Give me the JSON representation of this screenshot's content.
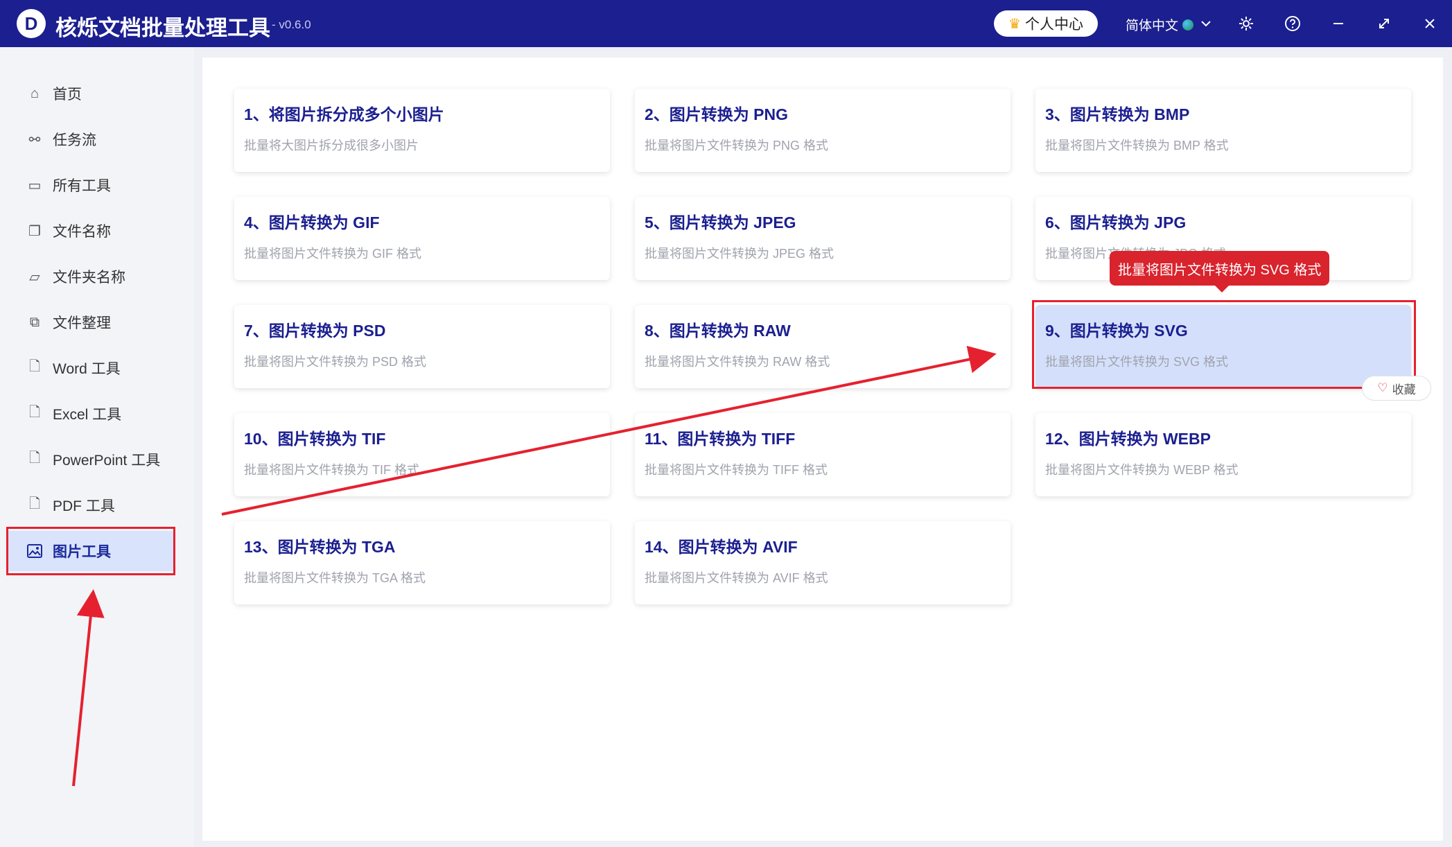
{
  "titlebar": {
    "logo_letter": "D",
    "title": "核烁文档批量处理工具",
    "version": "- v0.6.0",
    "user_center": "个人中心",
    "language": "简体中文",
    "icons": [
      "chevron-down-icon",
      "gear-icon",
      "help-icon",
      "minimize-icon",
      "maximize-icon",
      "close-icon"
    ]
  },
  "sidebar": {
    "items": [
      {
        "label": "首页",
        "icon": "home-icon"
      },
      {
        "label": "任务流",
        "icon": "workflow-icon"
      },
      {
        "label": "所有工具",
        "icon": "monitor-icon"
      },
      {
        "label": "文件名称",
        "icon": "file-name-icon"
      },
      {
        "label": "文件夹名称",
        "icon": "folder-icon"
      },
      {
        "label": "文件整理",
        "icon": "organize-icon"
      },
      {
        "label": "Word 工具",
        "icon": "word-icon"
      },
      {
        "label": "Excel 工具",
        "icon": "excel-icon"
      },
      {
        "label": "PowerPoint 工具",
        "icon": "powerpoint-icon"
      },
      {
        "label": "PDF 工具",
        "icon": "pdf-icon"
      },
      {
        "label": "图片工具",
        "icon": "image-icon",
        "active": true
      }
    ]
  },
  "tools": [
    {
      "title": "1、将图片拆分成多个小图片",
      "desc": "批量将大图片拆分成很多小图片"
    },
    {
      "title": "2、图片转换为 PNG",
      "desc": "批量将图片文件转换为 PNG 格式"
    },
    {
      "title": "3、图片转换为 BMP",
      "desc": "批量将图片文件转换为 BMP 格式"
    },
    {
      "title": "4、图片转换为 GIF",
      "desc": "批量将图片文件转换为 GIF 格式"
    },
    {
      "title": "5、图片转换为 JPEG",
      "desc": "批量将图片文件转换为 JPEG 格式"
    },
    {
      "title": "6、图片转换为 JPG",
      "desc": "批量将图片文件转换为 JPG 格式"
    },
    {
      "title": "7、图片转换为 PSD",
      "desc": "批量将图片文件转换为 PSD 格式"
    },
    {
      "title": "8、图片转换为 RAW",
      "desc": "批量将图片文件转换为 RAW 格式"
    },
    {
      "title": "9、图片转换为 SVG",
      "desc": "批量将图片文件转换为 SVG 格式",
      "selected": true
    },
    {
      "title": "10、图片转换为 TIF",
      "desc": "批量将图片文件转换为 TIF 格式"
    },
    {
      "title": "11、图片转换为 TIFF",
      "desc": "批量将图片文件转换为 TIFF 格式"
    },
    {
      "title": "12、图片转换为 WEBP",
      "desc": "批量将图片文件转换为 WEBP 格式"
    },
    {
      "title": "13、图片转换为 TGA",
      "desc": "批量将图片文件转换为 TGA 格式"
    },
    {
      "title": "14、图片转换为 AVIF",
      "desc": "批量将图片文件转换为 AVIF 格式"
    }
  ],
  "tooltip": "批量将图片文件转换为 SVG 格式",
  "favorite_label": "收藏",
  "colors": {
    "titlebar": "#1b1f8f",
    "accent": "#1b2a9c",
    "annotation_red": "#e5212f",
    "selected_card": "#d4e0fb"
  }
}
